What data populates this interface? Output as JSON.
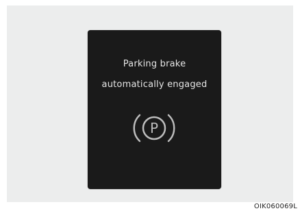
{
  "display": {
    "line1": "Parking brake",
    "line2": "automatically engaged",
    "icon": "parking-brake-icon",
    "icon_letter": "P",
    "screen_color": "#1a1a1a",
    "text_color": "#e6e6e6"
  },
  "caption": "OIK060069L"
}
